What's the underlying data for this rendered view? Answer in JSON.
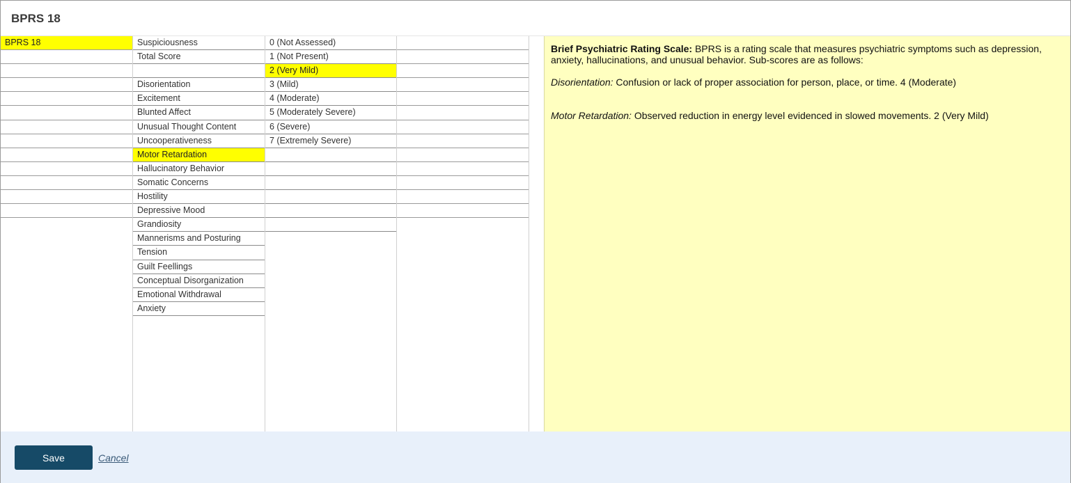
{
  "title": "BPRS 18",
  "columns": {
    "scales": [
      {
        "label": "BPRS 18",
        "selected": true
      },
      {
        "label": ""
      },
      {
        "label": ""
      },
      {
        "label": ""
      },
      {
        "label": ""
      },
      {
        "label": ""
      },
      {
        "label": ""
      },
      {
        "label": ""
      },
      {
        "label": ""
      },
      {
        "label": ""
      },
      {
        "label": ""
      },
      {
        "label": ""
      },
      {
        "label": ""
      }
    ],
    "items": [
      {
        "label": "Suspiciousness"
      },
      {
        "label": "Total Score"
      },
      {
        "label": ""
      },
      {
        "label": "Disorientation"
      },
      {
        "label": "Excitement"
      },
      {
        "label": "Blunted Affect"
      },
      {
        "label": "Unusual Thought Content"
      },
      {
        "label": "Uncooperativeness"
      },
      {
        "label": "Motor Retardation",
        "selected": true
      },
      {
        "label": "Hallucinatory Behavior"
      },
      {
        "label": "Somatic Concerns"
      },
      {
        "label": "Hostility"
      },
      {
        "label": "Depressive Mood"
      },
      {
        "label": "Grandiosity"
      },
      {
        "label": "Mannerisms and Posturing"
      },
      {
        "label": "Tension"
      },
      {
        "label": "Guilt Feellings"
      },
      {
        "label": "Conceptual Disorganization"
      },
      {
        "label": "Emotional Withdrawal"
      },
      {
        "label": "Anxiety"
      }
    ],
    "ratings": [
      {
        "label": "0 (Not Assessed)"
      },
      {
        "label": "1 (Not Present)"
      },
      {
        "label": "2 (Very Mild)",
        "selected": true
      },
      {
        "label": "3 (Mild)"
      },
      {
        "label": "4 (Moderate)"
      },
      {
        "label": "5 (Moderately Severe)"
      },
      {
        "label": "6 (Severe)"
      },
      {
        "label": "7 (Extremely Severe)"
      },
      {
        "label": ""
      },
      {
        "label": ""
      },
      {
        "label": ""
      },
      {
        "label": ""
      },
      {
        "label": ""
      },
      {
        "label": ""
      }
    ],
    "extra": [
      {
        "label": ""
      },
      {
        "label": ""
      },
      {
        "label": ""
      },
      {
        "label": ""
      },
      {
        "label": ""
      },
      {
        "label": ""
      },
      {
        "label": ""
      },
      {
        "label": ""
      },
      {
        "label": ""
      },
      {
        "label": ""
      },
      {
        "label": ""
      },
      {
        "label": ""
      },
      {
        "label": ""
      }
    ]
  },
  "info": {
    "intro_label": "Brief Psychiatric Rating Scale:",
    "intro_text": " BPRS is a rating scale that measures psychiatric symptoms such as depression, anxiety, hallucinations, and unusual behavior. Sub-scores are as follows:",
    "entries": [
      {
        "name": "Disorientation:",
        "text": " Confusion or lack of proper association for person, place, or time. 4 (Moderate)"
      },
      {
        "name": "Motor Retardation:",
        "text": " Observed reduction in energy level evidenced in slowed movements. 2 (Very Mild)"
      }
    ]
  },
  "footer": {
    "save_label": "Save",
    "cancel_label": "Cancel"
  },
  "colors": {
    "selected_highlight": "#ffff00",
    "info_background": "#ffffc0",
    "save_button": "#164a67",
    "footer_background": "#e8f0fa"
  }
}
